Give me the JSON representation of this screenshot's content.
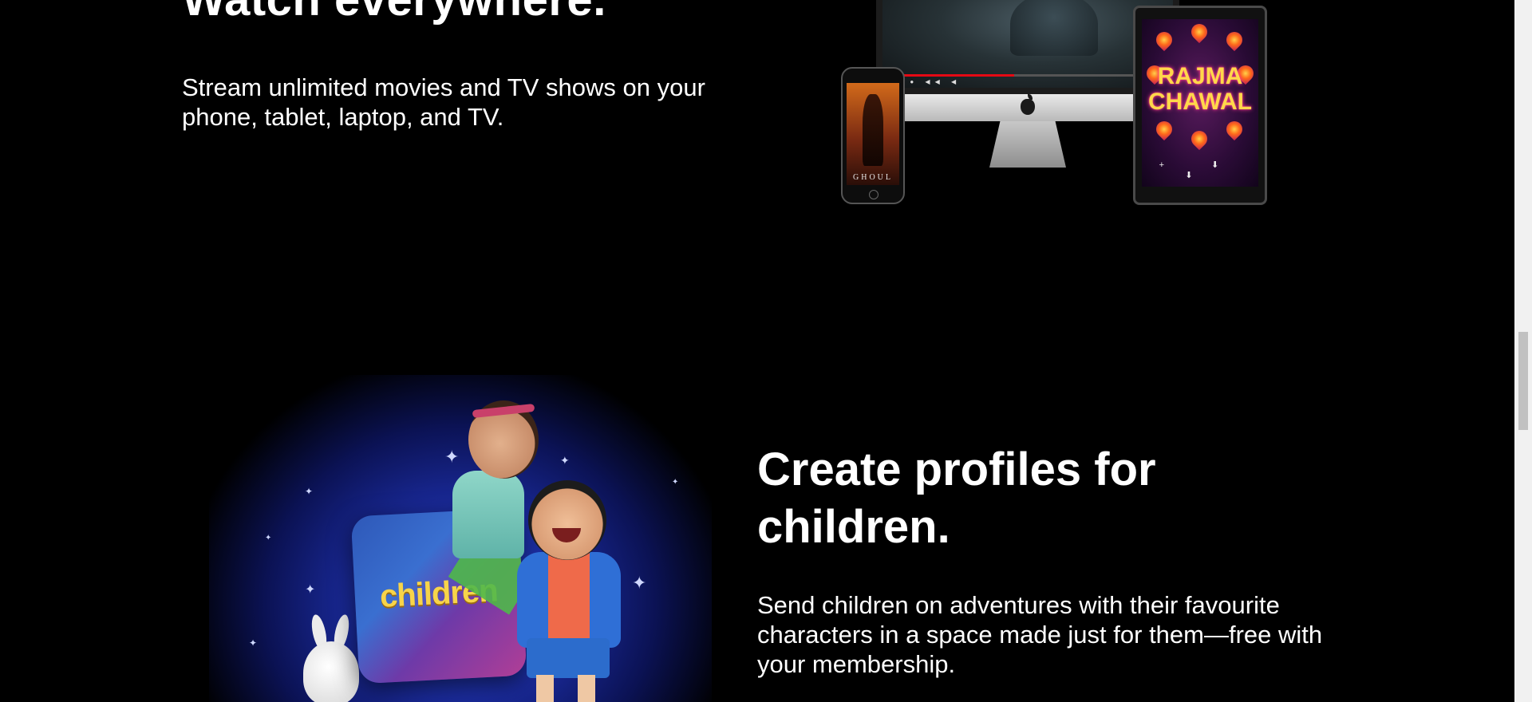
{
  "sections": [
    {
      "title": "Watch everywhere.",
      "text": "Stream unlimited movies and TV shows on your phone, tablet, laptop, and TV."
    },
    {
      "title": "Create profiles for children.",
      "text": "Send children on adventures with their favourite characters in a space made just for them—free with your membership."
    }
  ],
  "devices_art": {
    "phone_poster_title": "GHOUL",
    "tablet_poster_title_line1": "RAJMA",
    "tablet_poster_title_line2": "CHAWAL",
    "imac_controls": "▶ ● ◀◀ ◀",
    "tablet_controls": "+ ⬇ ⬇",
    "playback_progress": 0.45
  },
  "kids_art": {
    "card_label": "children"
  },
  "scrollbar": {
    "position_fraction": 0.55,
    "visible_fraction": 0.14
  }
}
